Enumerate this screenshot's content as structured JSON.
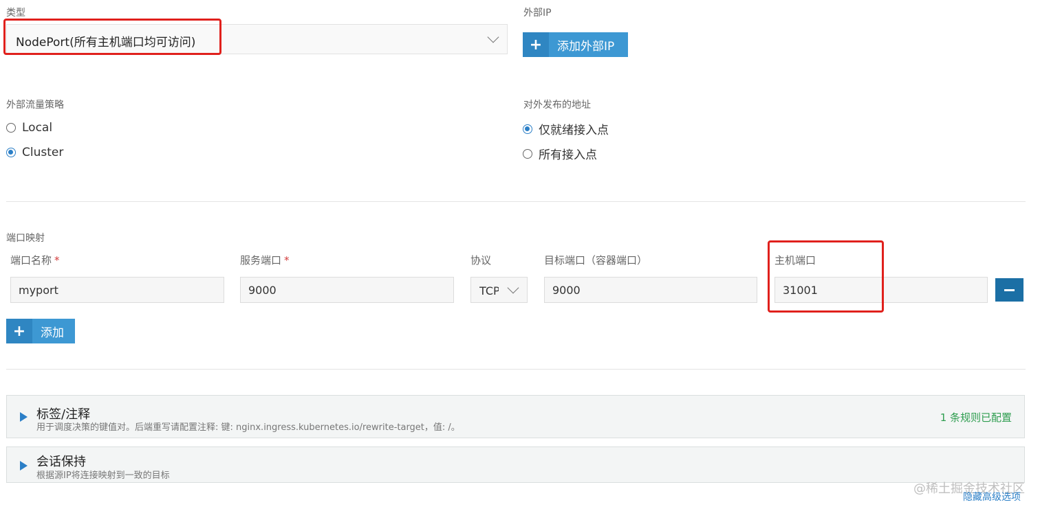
{
  "service_type": {
    "label": "类型",
    "value": "NodePort(所有主机端口均可访问)"
  },
  "external_ip": {
    "label": "外部IP",
    "add_button": "添加外部IP"
  },
  "traffic_policy": {
    "label": "外部流量策略",
    "options": [
      {
        "label": "Local",
        "checked": false
      },
      {
        "label": "Cluster",
        "checked": true
      }
    ]
  },
  "publish_address": {
    "label": "对外发布的地址",
    "options": [
      {
        "label": "仅就绪接入点",
        "checked": true
      },
      {
        "label": "所有接入点",
        "checked": false
      }
    ]
  },
  "port_mapping": {
    "label": "端口映射",
    "columns": {
      "port_name": "端口名称",
      "service_port": "服务端口",
      "protocol": "协议",
      "target_port": "目标端口（容器端口）",
      "host_port": "主机端口"
    },
    "required_mark": "*",
    "row": {
      "port_name": "myport",
      "service_port": "9000",
      "protocol": "TCP",
      "target_port": "9000",
      "host_port": "31001"
    },
    "add_button": "添加"
  },
  "labels_panel": {
    "title": "标签/注释",
    "subtitle": "用于调度决策的键值对。后端重写请配置注释: 键: nginx.ingress.kubernetes.io/rewrite-target，值: /。",
    "status": "1 条规则已配置"
  },
  "session_panel": {
    "title": "会话保持",
    "subtitle": "根据源IP将连接映射到一致的目标"
  },
  "footer": {
    "hide_advanced": "隐藏高级选项",
    "watermark": "@稀土掘金技术社区"
  },
  "colors": {
    "primary": "#3d98d3",
    "highlight_border": "#e0201c",
    "status_green": "#2e9d4f"
  }
}
